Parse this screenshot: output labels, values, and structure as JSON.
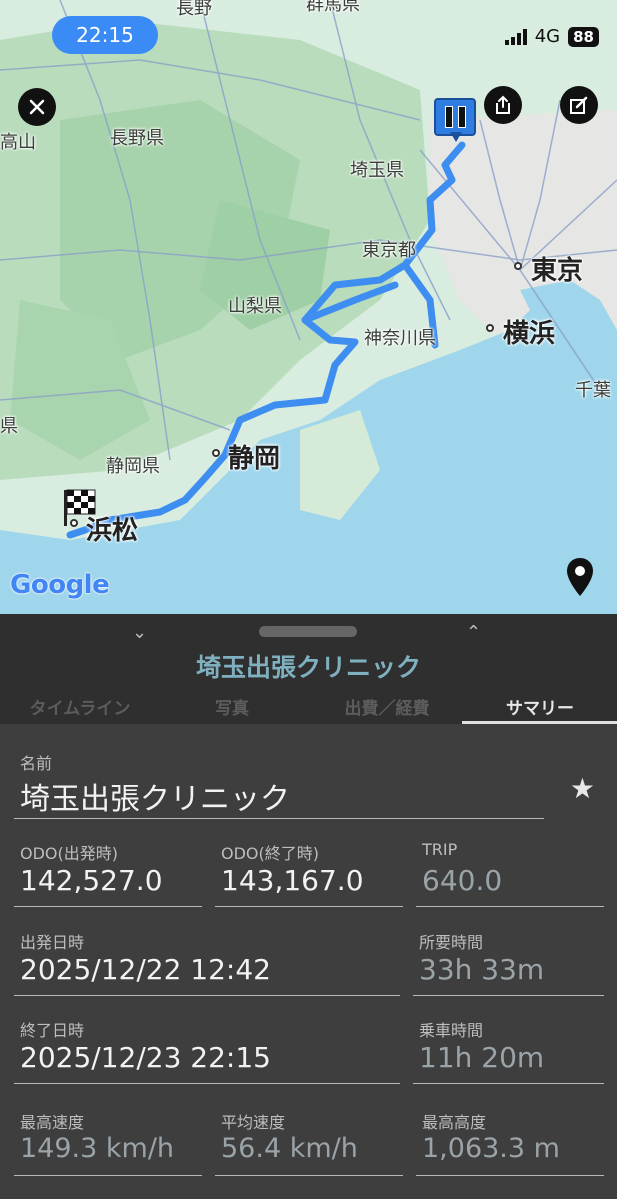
{
  "status_bar": {
    "time": "22:15",
    "network": "4G",
    "battery": "88"
  },
  "map": {
    "labels": {
      "nagano_city": "長野",
      "gunma": "群馬県",
      "nagano_pref": "長野県",
      "saitama_pref": "埼玉県",
      "tokyo_to": "東京都",
      "tokyo": "東京",
      "yamanashi": "山梨県",
      "kanagawa": "神奈川県",
      "yokohama": "横浜",
      "chiba": "千葉",
      "shizuoka_pref": "静岡県",
      "shizuoka": "静岡",
      "hamamatsu": "浜松",
      "ken_edge": "県",
      "takayama_edge": "高山"
    },
    "attribution": "Google",
    "icons": {
      "close": "close-icon",
      "share": "share-icon",
      "edit": "edit-icon",
      "pause": "pause-icon",
      "finish": "finish-flag-icon",
      "location": "location-pin-icon"
    },
    "route_color": "#3d8ef0"
  },
  "sheet": {
    "title": "埼玉出張クリニック",
    "tabs": [
      "タイムライン",
      "写真",
      "出費／経費",
      "サマリー"
    ],
    "active_tab": "サマリー"
  },
  "summary": {
    "name_label": "名前",
    "name_value": "埼玉出張クリニック",
    "odo_start_label": "ODO(出発時)",
    "odo_start_value": "142,527.0",
    "odo_end_label": "ODO(終了時)",
    "odo_end_value": "143,167.0",
    "trip_label": "TRIP",
    "trip_value": "640.0",
    "depart_label": "出発日時",
    "depart_value": "2025/12/22 12:42",
    "duration_label": "所要時間",
    "duration_value": "33h 33m",
    "end_label": "終了日時",
    "end_value": "2025/12/23 22:15",
    "ride_label": "乗車時間",
    "ride_value": "11h 20m",
    "max_speed_label": "最高速度",
    "max_speed_value": "149.3 km/h",
    "avg_speed_label": "平均速度",
    "avg_speed_value": "56.4 km/h",
    "max_alt_label": "最高高度",
    "max_alt_value": "1,063.3 m"
  }
}
